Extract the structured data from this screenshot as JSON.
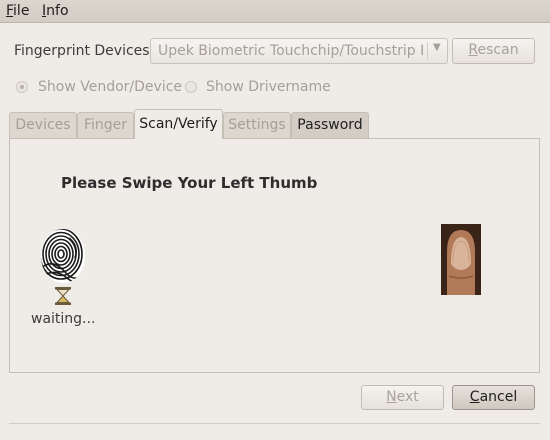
{
  "menu": [
    {
      "mnemonic": "F",
      "rest": "ile"
    },
    {
      "mnemonic": "I",
      "rest": "nfo"
    }
  ],
  "devices": {
    "label": "Fingerprint Devices:",
    "selected": "Upek Biometric Touchchip/Touchstrip Fingerprint Sensor",
    "rescan": {
      "mnemonic": "R",
      "rest": "escan"
    }
  },
  "options": {
    "show_vendor": "Show Vendor/Device",
    "show_drivername": "Show Drivername"
  },
  "tabs": [
    "Devices",
    "Finger",
    "Scan/Verify",
    "Settings",
    "Password"
  ],
  "scan": {
    "heading": "Please Swipe Your Left Thumb",
    "status": "waiting..."
  },
  "buttons": {
    "next": {
      "mnemonic": "N",
      "rest": "ext"
    },
    "cancel": {
      "mnemonic": "C",
      "rest": "ancel"
    }
  },
  "icons": {
    "fingerprint": "fingerprint-icon",
    "hourglass": "hourglass-icon",
    "thumb": "thumb-photo-icon"
  }
}
